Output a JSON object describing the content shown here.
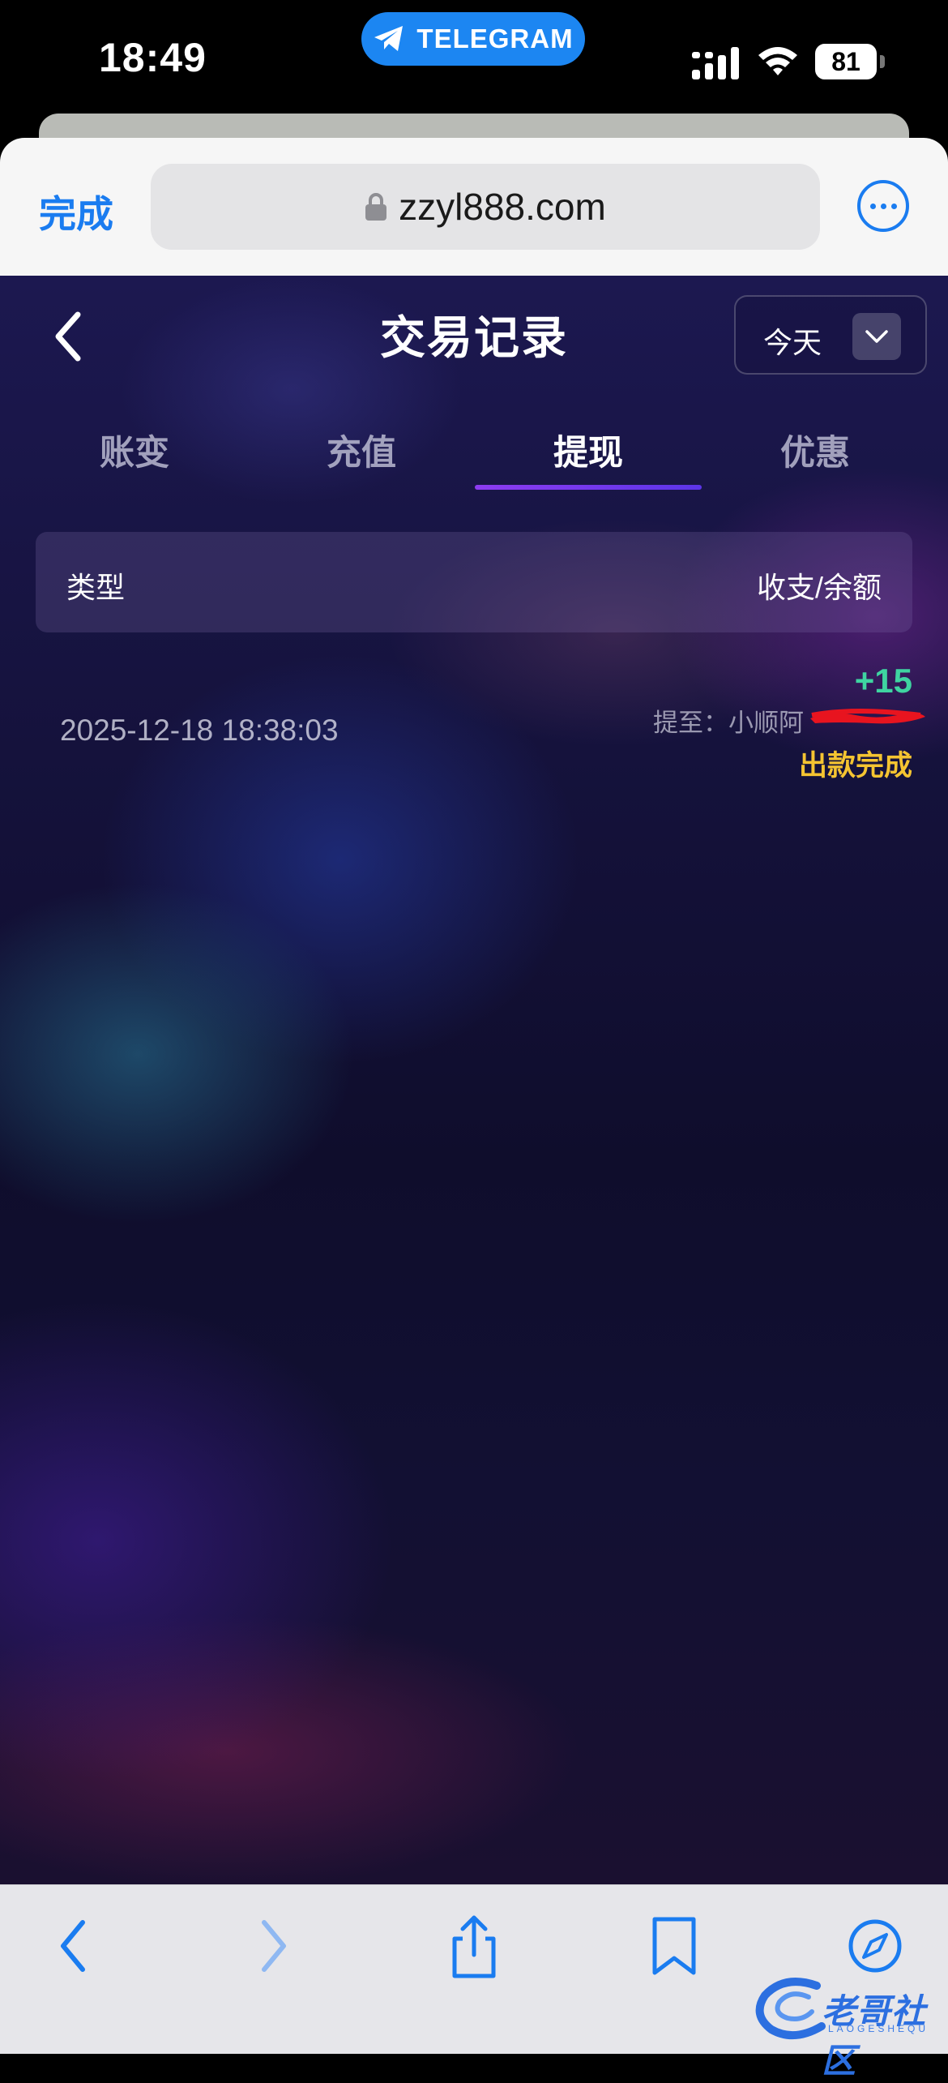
{
  "status_bar": {
    "time": "18:49",
    "telegram_label": "TELEGRAM",
    "battery_level": "81",
    "icons": [
      "telegram-icon",
      "signal-icon",
      "wifi-icon",
      "battery-icon"
    ]
  },
  "browser": {
    "done_label": "完成",
    "url": "zzyl888.com",
    "icons": [
      "lock-icon",
      "more-icon"
    ]
  },
  "page": {
    "title": "交易记录",
    "date_filter": {
      "selected": "今天"
    },
    "tabs": [
      {
        "label": "账变",
        "active": false
      },
      {
        "label": "充值",
        "active": false
      },
      {
        "label": "提现",
        "active": true
      },
      {
        "label": "优惠",
        "active": false
      }
    ],
    "table_header": {
      "type_label": "类型",
      "amount_label": "收支/余额"
    },
    "records": [
      {
        "time": "2025-12-18 18:38:03",
        "amount": "+15",
        "destination": "提至：小顺阿",
        "status": "出款完成"
      }
    ]
  },
  "toolbar": {
    "icons": [
      "back-arrow-icon",
      "forward-arrow-icon",
      "share-icon",
      "bookmarks-icon",
      "compass-icon"
    ]
  },
  "watermark": {
    "text": "老哥社区",
    "subtext": "LAOGESHEQU"
  },
  "colors": {
    "accent_blue": "#1a7cf0",
    "amount_green": "#3fd4a1",
    "status_yellow": "#f5c431",
    "tab_indicator": "#7b3ff0",
    "telegram_blue": "#1c86f2"
  }
}
